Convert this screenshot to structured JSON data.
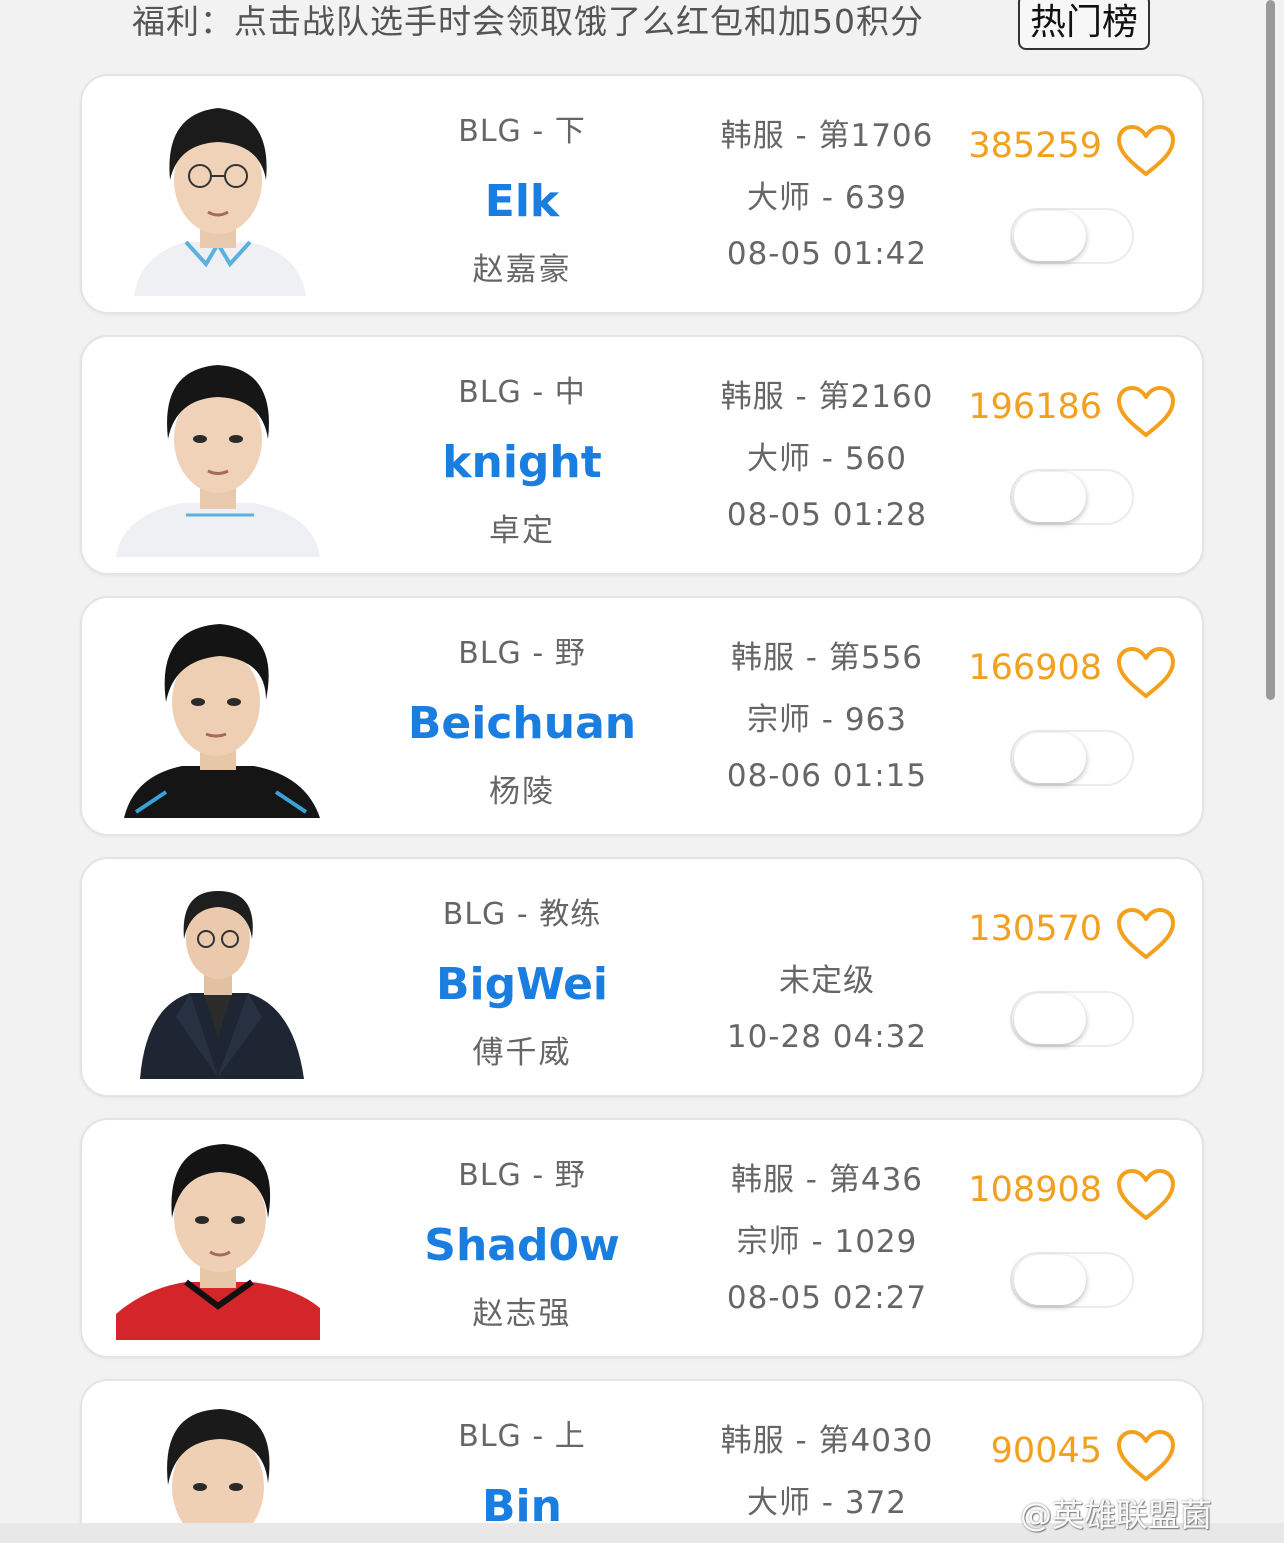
{
  "header": {
    "promo_text": "福利：点击战队选手时会领取饿了么红包和加50积分",
    "hot_button": "热门榜"
  },
  "colors": {
    "name": "#1a7de0",
    "score": "#f2a01e",
    "heart": "#f2a01e",
    "text": "#666666"
  },
  "players": [
    {
      "team_pos": "BLG - 下",
      "name": "Elk",
      "real_name": "赵嘉豪",
      "server_rank": "韩服 - 第1706",
      "tier": "大师 - 639",
      "updated": "08-05 01:42",
      "score": "385259",
      "jersey": "white",
      "toggle_on": false
    },
    {
      "team_pos": "BLG - 中",
      "name": "knight",
      "real_name": "卓定",
      "server_rank": "韩服 - 第2160",
      "tier": "大师 - 560",
      "updated": "08-05 01:28",
      "score": "196186",
      "jersey": "white",
      "toggle_on": false
    },
    {
      "team_pos": "BLG - 野",
      "name": "Beichuan",
      "real_name": "杨陵",
      "server_rank": "韩服 - 第556",
      "tier": "宗师 - 963",
      "updated": "08-06 01:15",
      "score": "166908",
      "jersey": "black",
      "toggle_on": false
    },
    {
      "team_pos": "BLG - 教练",
      "name": "BigWei",
      "real_name": "傅千威",
      "server_rank": "",
      "tier": "未定级",
      "updated": "10-28 04:32",
      "score": "130570",
      "jersey": "suit",
      "toggle_on": false
    },
    {
      "team_pos": "BLG - 野",
      "name": "Shad0w",
      "real_name": "赵志强",
      "server_rank": "韩服 - 第436",
      "tier": "宗师 - 1029",
      "updated": "08-05 02:27",
      "score": "108908",
      "jersey": "red",
      "toggle_on": false
    },
    {
      "team_pos": "BLG - 上",
      "name": "Bin",
      "real_name": "",
      "server_rank": "韩服 - 第4030",
      "tier": "大师 - 372",
      "updated": "",
      "score": "90045",
      "jersey": "white",
      "toggle_on": false
    }
  ],
  "watermark": "@英雄联盟菌"
}
